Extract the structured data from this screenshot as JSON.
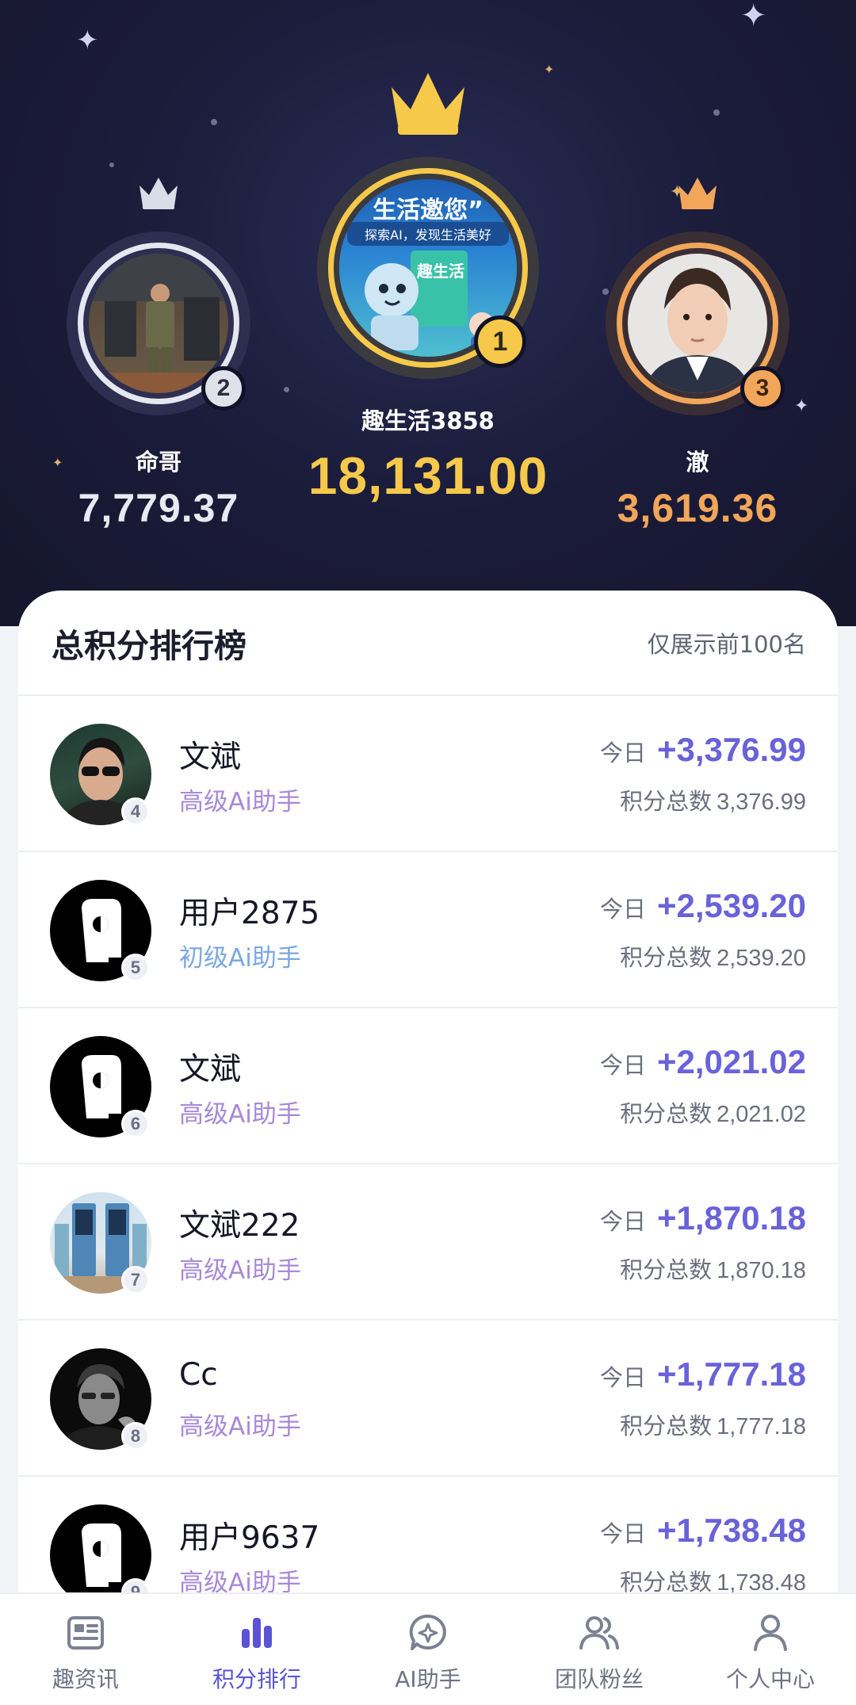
{
  "podium": {
    "first": {
      "rank": "1",
      "name": "趣生活3858",
      "score": "18,131.00",
      "avatar_text_top": "生活邀您”",
      "avatar_text_mid": "探索AI，发现生活美好",
      "avatar_text_book": "趣生活"
    },
    "second": {
      "rank": "2",
      "name": "命哥",
      "score": "7,779.37"
    },
    "third": {
      "rank": "3",
      "name": "澈",
      "score": "3,619.36"
    }
  },
  "board": {
    "title": "总积分排行榜",
    "note": "仅展示前100名",
    "today_label": "今日",
    "total_label": "积分总数",
    "rows": [
      {
        "rank": "4",
        "name": "文斌",
        "level": "高级Ai助手",
        "today": "+3,376.99",
        "total": "3,376.99"
      },
      {
        "rank": "5",
        "name": "用户2875",
        "level": "初级Ai助手",
        "today": "+2,539.20",
        "total": "2,539.20"
      },
      {
        "rank": "6",
        "name": "文斌",
        "level": "高级Ai助手",
        "today": "+2,021.02",
        "total": "2,021.02"
      },
      {
        "rank": "7",
        "name": "文斌222",
        "level": "高级Ai助手",
        "today": "+1,870.18",
        "total": "1,870.18"
      },
      {
        "rank": "8",
        "name": "Cc",
        "level": "高级Ai助手",
        "today": "+1,777.18",
        "total": "1,777.18"
      },
      {
        "rank": "9",
        "name": "用户9637",
        "level": "高级Ai助手",
        "today": "+1,738.48",
        "total": "1,738.48"
      }
    ]
  },
  "tabs": [
    {
      "label": "趣资讯",
      "icon": "news-icon"
    },
    {
      "label": "积分排行",
      "icon": "bar-chart-icon",
      "active": true
    },
    {
      "label": "AI助手",
      "icon": "ai-chat-icon"
    },
    {
      "label": "团队粉丝",
      "icon": "team-icon"
    },
    {
      "label": "个人中心",
      "icon": "user-icon"
    }
  ],
  "colors": {
    "gold": "#f6c94a",
    "silver": "#d9dde8",
    "bronze": "#f2a65a",
    "accent": "#6a62d8"
  }
}
